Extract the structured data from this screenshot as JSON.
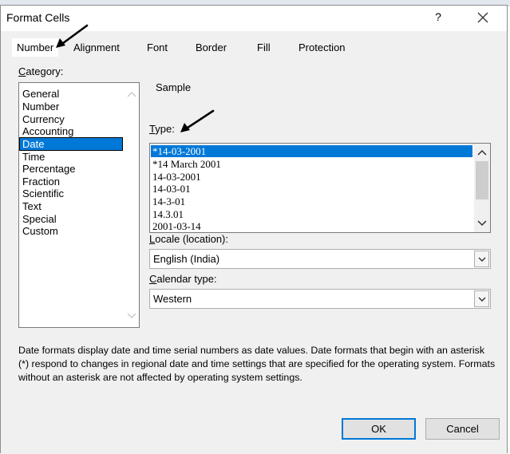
{
  "dialog": {
    "title": "Format Cells",
    "help_label": "?"
  },
  "tabs": [
    {
      "label": "Number",
      "active": true
    },
    {
      "label": "Alignment",
      "active": false
    },
    {
      "label": "Font",
      "active": false
    },
    {
      "label": "Border",
      "active": false
    },
    {
      "label": "Fill",
      "active": false
    },
    {
      "label": "Protection",
      "active": false
    }
  ],
  "category": {
    "label_underlined": "C",
    "label_rest": "ategory:",
    "items": [
      "General",
      "Number",
      "Currency",
      "Accounting",
      "Date",
      "Time",
      "Percentage",
      "Fraction",
      "Scientific",
      "Text",
      "Special",
      "Custom"
    ],
    "selected": "Date"
  },
  "sample": {
    "label": "Sample"
  },
  "type": {
    "label_underlined": "T",
    "label_rest": "ype:",
    "items": [
      "*14-03-2001",
      "*14 March 2001",
      "14-03-2001",
      "14-03-01",
      "14-3-01",
      "14.3.01",
      "2001-03-14"
    ],
    "selected": "*14-03-2001"
  },
  "locale": {
    "label_underlined": "L",
    "label_rest": "ocale (location):",
    "value": "English (India)"
  },
  "calendar": {
    "label_underlined": "C",
    "label_rest": "alendar type:",
    "value": "Western"
  },
  "description": "Date formats display date and time serial numbers as date values.  Date formats that begin with an asterisk (*) respond to changes in regional date and time settings that are specified for the operating system. Formats without an asterisk are not affected by operating system settings.",
  "buttons": {
    "ok": "OK",
    "cancel": "Cancel"
  },
  "colors": {
    "selection": "#0078d7",
    "dialog_bg": "#f0f0f0",
    "default_button_border": "#0078d7"
  },
  "icons": [
    "close-icon",
    "scroll-up-icon",
    "scroll-down-icon",
    "dropdown-arrow-icon",
    "annotation-arrow-icon"
  ]
}
